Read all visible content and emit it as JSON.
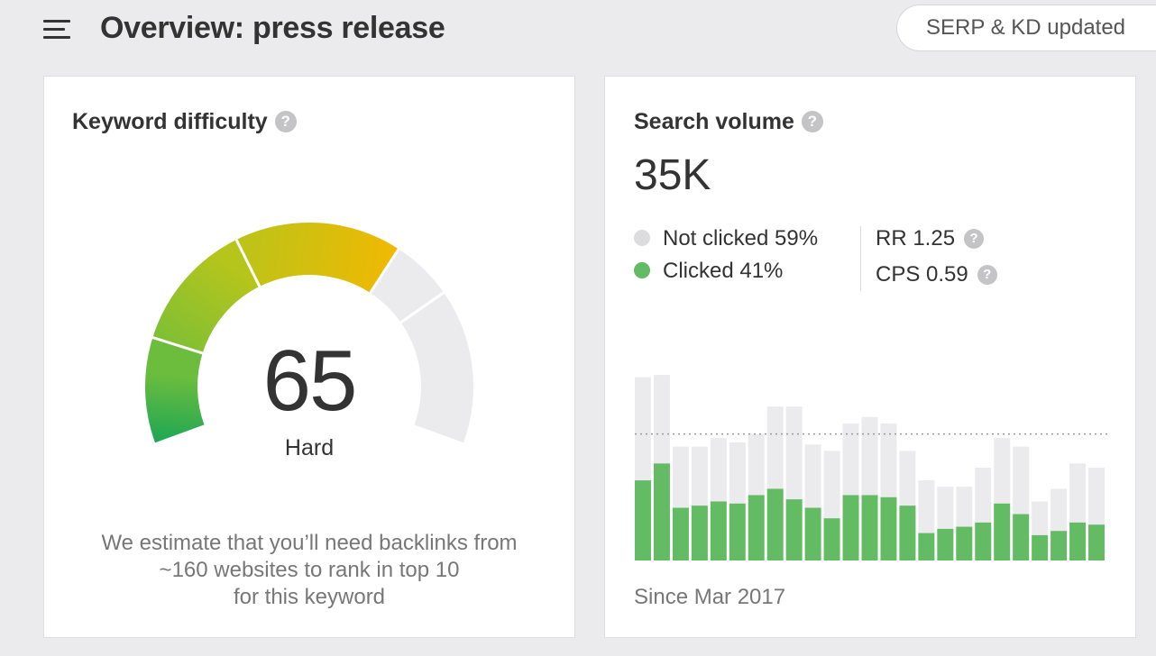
{
  "header": {
    "title": "Overview: press release",
    "status_text": "SERP & KD updated"
  },
  "keyword_difficulty": {
    "title": "Keyword difficulty",
    "help_glyph": "?",
    "score": "65",
    "score_value": 65,
    "level_label": "Hard",
    "estimate_lines": [
      "We estimate that you’ll need backlinks from",
      "~160 websites to rank in top 10",
      "for this keyword"
    ],
    "colors": {
      "green_dark": "#0fa25a",
      "green": "#6cbd3d",
      "yellow_green": "#b5c51c",
      "orange": "#f5b800",
      "empty": "#ebebed"
    }
  },
  "search_volume": {
    "title": "Search volume",
    "help_glyph": "?",
    "value": "35K",
    "not_clicked_label": "Not clicked 59%",
    "clicked_label": "Clicked 41%",
    "rr_label": "RR 1.25",
    "cps_label": "CPS 0.59",
    "since_label": "Since Mar 2017",
    "colors": {
      "not_clicked": "#dcdcde",
      "clicked": "#63bb63",
      "bar_background": "#ebebed"
    }
  },
  "chart_data": {
    "type": "bar",
    "stacked": true,
    "ylim": [
      0,
      100
    ],
    "reference_line": 60,
    "series": [
      {
        "name": "Clicked",
        "values": [
          38,
          46,
          25,
          26,
          28,
          27,
          31,
          34,
          29,
          25,
          20,
          31,
          31,
          30,
          26,
          13,
          15,
          16,
          18,
          27,
          22,
          12,
          14,
          18,
          17
        ]
      },
      {
        "name": "Not clicked",
        "values": [
          49,
          42,
          29,
          28,
          30,
          29,
          29,
          39,
          44,
          30,
          32,
          34,
          37,
          35,
          26,
          25,
          20,
          19,
          26,
          31,
          32,
          16,
          20,
          28,
          27
        ]
      }
    ]
  }
}
